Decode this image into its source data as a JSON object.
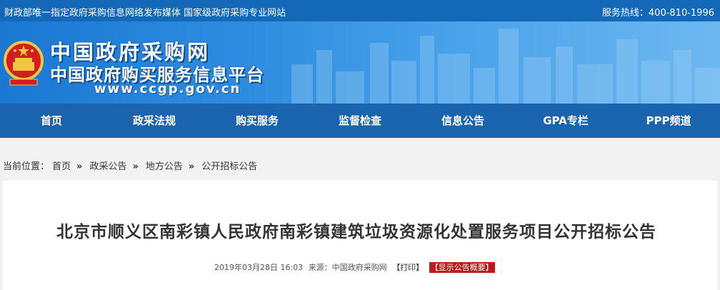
{
  "topbar": {
    "slogan": "财政部唯一指定政府采购信息网络发布媒体  国家级政府采购专业网站",
    "hotline": "服务热线：400-810-1996"
  },
  "banner": {
    "title": "中国政府采购网",
    "subtitle": "中国政府购买服务信息平台",
    "url": "www.ccgp.gov.cn"
  },
  "nav": {
    "items": [
      {
        "label": "首页"
      },
      {
        "label": "政采法规"
      },
      {
        "label": "购买服务"
      },
      {
        "label": "监督检查"
      },
      {
        "label": "信息公告"
      },
      {
        "label": "GPA专栏"
      },
      {
        "label": "PPP频道"
      }
    ]
  },
  "breadcrumb": {
    "prefix": "当前位置：",
    "items": [
      "首页",
      "政采公告",
      "地方公告",
      "公开招标公告"
    ],
    "separator": "»"
  },
  "article": {
    "title": "北京市顺义区南彩镇人民政府南彩镇建筑垃圾资源化处置服务项目公开招标公告",
    "datetime": "2019年03月28日 16:03",
    "source": "来源：中国政府采购网",
    "print": "【打印】",
    "summary": "【显示公告概要】"
  },
  "colors": {
    "topbar": "#1368b8",
    "nav": "#1a63ad",
    "summary_badge": "#c0171d"
  }
}
